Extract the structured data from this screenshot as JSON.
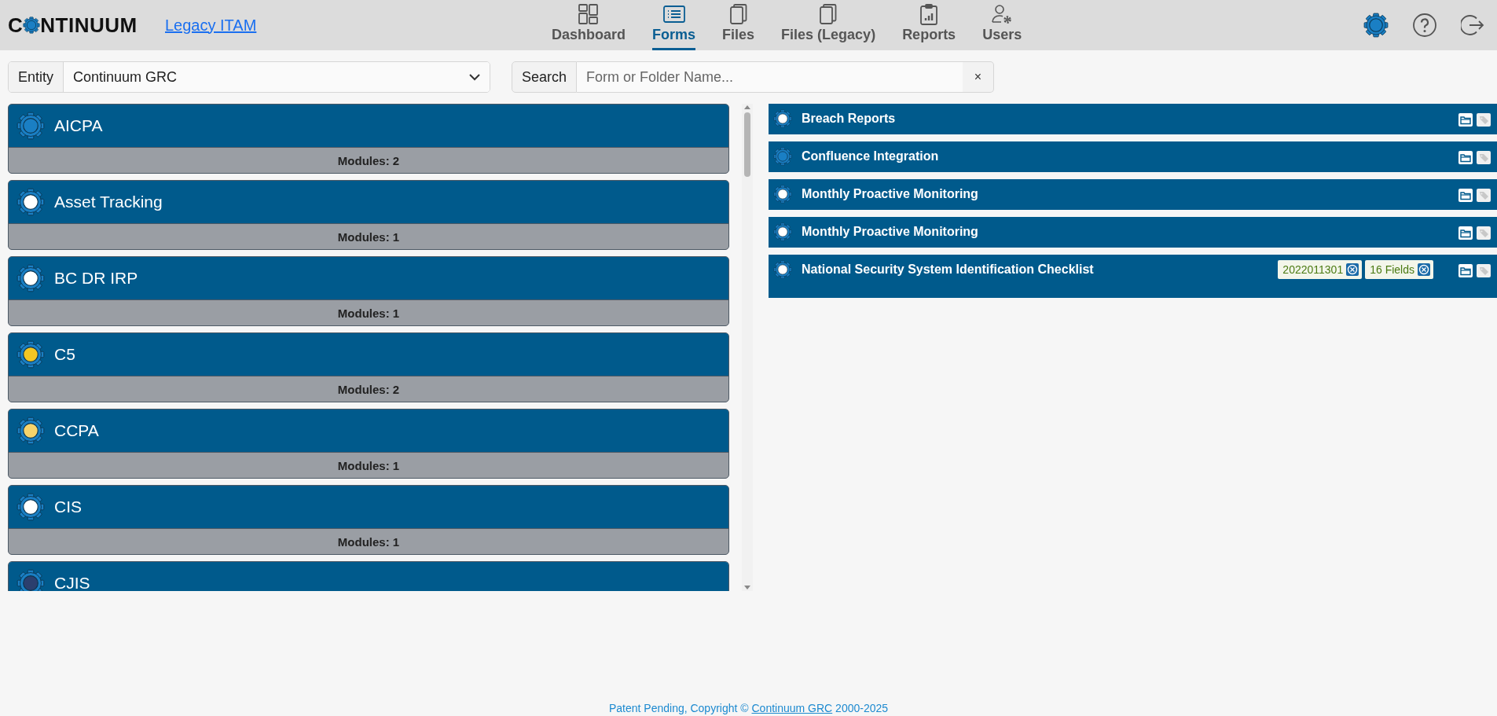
{
  "header": {
    "logo": {
      "parts": [
        "C",
        "NTINUUM"
      ]
    },
    "legacy_link": "Legacy ITAM",
    "nav": [
      {
        "label": "Dashboard",
        "kind": "dashboard",
        "selected": false
      },
      {
        "label": "Forms",
        "kind": "forms",
        "selected": true
      },
      {
        "label": "Files",
        "kind": "files",
        "selected": false
      },
      {
        "label": "Files (Legacy)",
        "kind": "files",
        "selected": false
      },
      {
        "label": "Reports",
        "kind": "reports",
        "selected": false
      },
      {
        "label": "Users",
        "kind": "users",
        "selected": false
      }
    ]
  },
  "entity": {
    "label": "Entity",
    "value": "Continuum GRC"
  },
  "search": {
    "label": "Search",
    "placeholder": "Form or Folder Name...",
    "clear": "×"
  },
  "frameworks": [
    {
      "name": "AICPA",
      "modules": "Modules: 2",
      "kind": "blue"
    },
    {
      "name": "Asset Tracking",
      "modules": "Modules: 1",
      "kind": "white"
    },
    {
      "name": "BC DR IRP",
      "modules": "Modules: 1",
      "kind": "white"
    },
    {
      "name": "C5",
      "modules": "Modules: 2",
      "kind": "flag"
    },
    {
      "name": "CCPA",
      "modules": "Modules: 1",
      "kind": "lock"
    },
    {
      "name": "CIS",
      "modules": "Modules: 1",
      "kind": "white"
    },
    {
      "name": "CJIS",
      "kind": "seal"
    }
  ],
  "forms": [
    {
      "name": "Breach Reports",
      "kind": "white"
    },
    {
      "name": "Confluence Integration",
      "kind": "blue"
    },
    {
      "name": "Monthly Proactive Monitoring",
      "kind": "white"
    },
    {
      "name": "Monthly Proactive Monitoring",
      "kind": "white"
    },
    {
      "name": "National Security System Identification Checklist",
      "kind": "white",
      "tags": [
        "2022011301",
        "16 Fields"
      ]
    }
  ],
  "footer": {
    "before": "Patent Pending, Copyright © ",
    "link": "Continuum GRC",
    "after": " 2000-2025"
  }
}
